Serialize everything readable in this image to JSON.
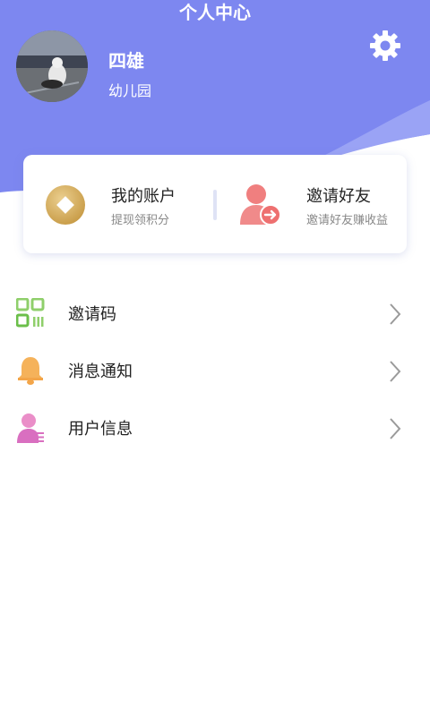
{
  "header": {
    "title": "个人中心",
    "bg_color": "#7c86f0",
    "user": {
      "name": "四雄",
      "org": "幼儿园"
    }
  },
  "icons": {
    "settings": "gear-icon",
    "avatar": "user-avatar-photo"
  },
  "card": {
    "account": {
      "title": "我的账户",
      "subtitle": "提现领积分",
      "icon": "coin-icon"
    },
    "invite": {
      "title": "邀请好友",
      "subtitle": "邀请好友赚收益",
      "icon": "person-arrow-icon"
    }
  },
  "menu": [
    {
      "label": "邀请码",
      "icon": "qr-code-icon"
    },
    {
      "label": "消息通知",
      "icon": "bell-icon"
    },
    {
      "label": "用户信息",
      "icon": "user-info-icon"
    }
  ]
}
